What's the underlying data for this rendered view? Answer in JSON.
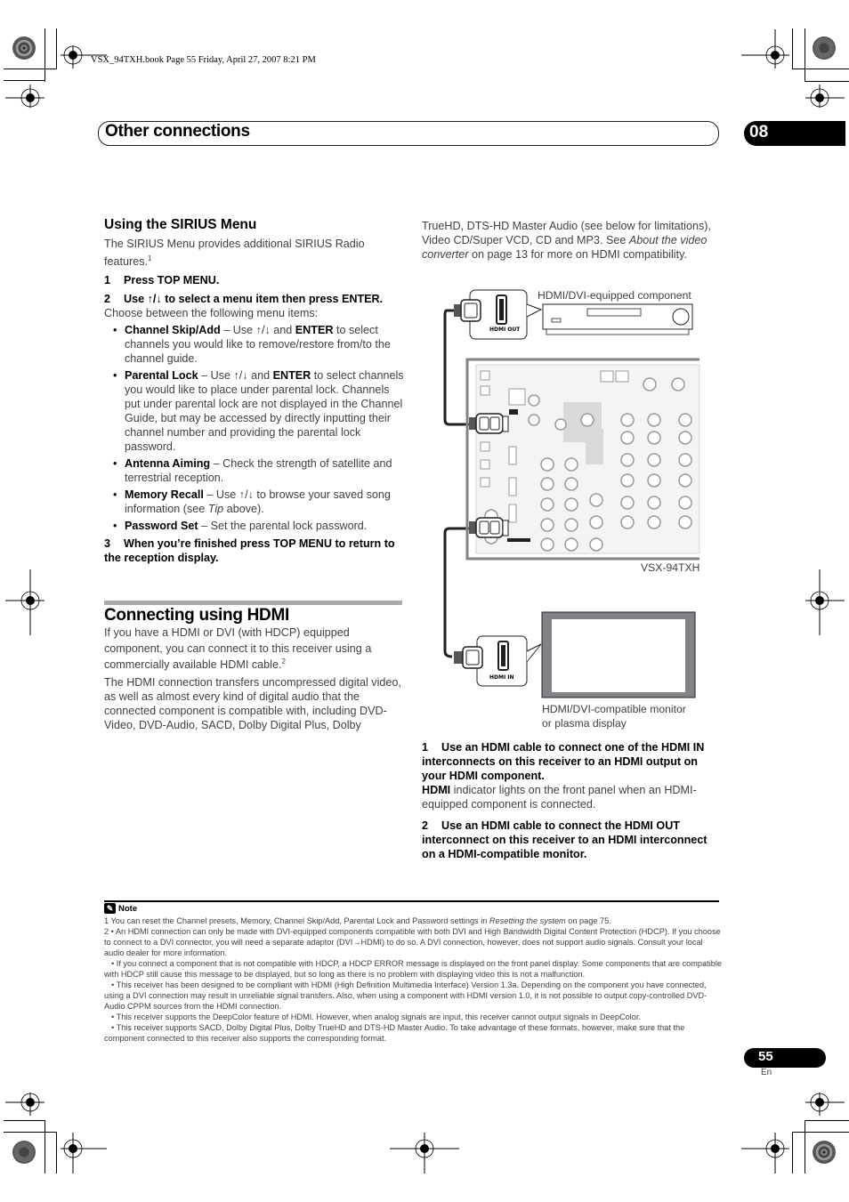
{
  "slug": "VSX_94TXH.book  Page 55  Friday, April 27, 2007  8:21 PM",
  "header": {
    "title": "Other connections",
    "chapter": "08"
  },
  "sirius": {
    "heading": "Using the SIRIUS Menu",
    "intro": "The SIRIUS Menu provides additional SIRIUS Radio features.",
    "intro_footnote": "1",
    "steps": [
      {
        "num": "1",
        "text": "Press TOP MENU."
      },
      {
        "num": "2",
        "text": "Use ↑/↓ to select a menu item then press ENTER."
      }
    ],
    "choose_text": "Choose between the following menu items:",
    "items": [
      {
        "term": "Channel Skip/Add",
        "desc_pre": " – Use ↑/↓ and ",
        "desc_bold": "ENTER",
        "desc_post": " to select channels you would like to remove/restore from/to the channel guide."
      },
      {
        "term": "Parental Lock",
        "desc_pre": " – Use ↑/↓ and ",
        "desc_bold": "ENTER",
        "desc_post": " to select channels you would like to place under parental lock. Channels put under parental lock are not displayed in the Channel Guide, but may be accessed by directly inputting their channel number and providing the parental lock password."
      },
      {
        "term": "Antenna Aiming",
        "desc_pre": " – Check the strength of satellite and terrestrial reception.",
        "desc_bold": "",
        "desc_post": ""
      },
      {
        "term": "Memory Recall",
        "desc_pre": " – Use ↑/↓ to browse your saved song information (see ",
        "desc_italic": "Tip",
        "desc_post": " above)."
      },
      {
        "term": "Password Set",
        "desc_pre": " – Set the parental lock password.",
        "desc_bold": "",
        "desc_post": ""
      }
    ],
    "step3": {
      "num": "3",
      "text": "When you’re finished press TOP MENU to return to the reception display."
    }
  },
  "hdmi": {
    "heading": "Connecting using HDMI",
    "para1": "If you have a HDMI or DVI (with HDCP) equipped component, you can connect it to this receiver using a commercially available HDMI cable.",
    "para1_footnote": "2",
    "para2": "The HDMI connection transfers uncompressed digital video, as well as almost every kind of digital audio that the connected component is compatible with, including DVD-Video, DVD-Audio, SACD, Dolby Digital Plus, Dolby",
    "para2_cont_pre": "TrueHD, DTS-HD Master Audio (see below for limitations), Video CD/Super VCD, CD and MP3. See ",
    "para2_cont_italic": "About the video converter",
    "para2_cont_post": " on page 13 for more on HDMI compatibility.",
    "diagram": {
      "component_label": "HDMI/DVI-equipped component",
      "hdmi_out_label": "HDMI OUT",
      "receiver_label": "VSX-94TXH",
      "hdmi_in_label": "HDMI IN",
      "monitor_label_line1": "HDMI/DVI-compatible monitor",
      "monitor_label_line2": "or plasma display"
    },
    "step1": {
      "num": "1",
      "text": "Use an HDMI cable to connect one of the HDMI IN interconnects on this receiver to an HDMI output on your HDMI component."
    },
    "step1_note_bold": "HDMI",
    "step1_note": " indicator lights on the front panel when an HDMI-equipped component is connected.",
    "step2": {
      "num": "2",
      "text": "Use an HDMI cable to connect the HDMI OUT interconnect on this receiver to an HDMI interconnect on a HDMI-compatible monitor."
    }
  },
  "notes": {
    "heading": "Note",
    "n1_pre": "1 You can reset the Channel presets, Memory, Channel Skip/Add, Parental Lock and Password settings in ",
    "n1_italic": "Resetting the system",
    "n1_post": " on page 75.",
    "n2": [
      "2  • An HDMI connection can only be made with DVI-equipped components compatible with both DVI and High Bandwidth Digital Content Protection (HDCP). If you choose to connect to a DVI connector, you will need a separate adaptor (DVI→HDMI) to do so. A DVI connection, however, does not support audio signals. Consult your local audio dealer for more information.",
      "• If you connect a component that is not compatible with HDCP, a HDCP ERROR message is displayed on the front panel display. Some components that are compatible with HDCP still cause this message to be displayed, but so long as there is no problem with displaying video this is not a malfunction.",
      "• This receiver has been designed to be compliant with HDMI (High Definition Multimedia Interface) Version 1.3a. Depending on the component you have connected, using a DVI connection may result in unreliable signal transfers. Also, when using a component with HDMI version 1.0, it is not possible to output copy-controlled DVD-Audio CPPM sources from the HDMI connection.",
      "• This receiver supports the DeepColor feature of HDMI. However, when analog signals are input, this receiver cannot output signals in DeepColor.",
      "• This receiver supports SACD, Dolby Digital Plus, Dolby TrueHD and DTS-HD Master Audio. To take advantage of these formats, however, make sure that the component connected to this receiver also supports the corresponding format."
    ]
  },
  "footer": {
    "page": "55",
    "lang": "En"
  }
}
